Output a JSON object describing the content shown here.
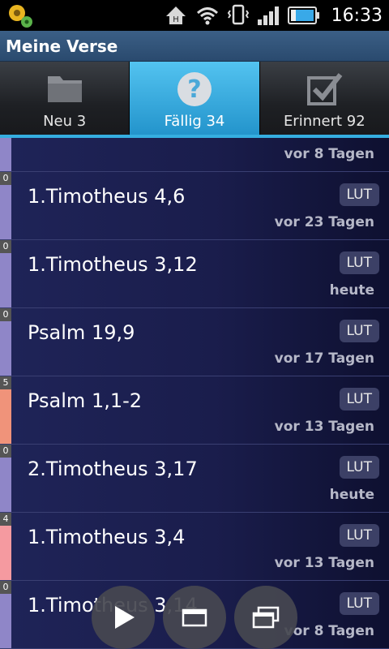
{
  "status_bar": {
    "time": "16:33",
    "icons": [
      "app-settings-icon",
      "h-network-icon",
      "wifi-icon",
      "vibrate-icon",
      "signal-icon",
      "battery-icon"
    ]
  },
  "header": {
    "title": "Meine Verse"
  },
  "tabs": [
    {
      "label": "Neu 3",
      "icon": "folder-icon",
      "active": false
    },
    {
      "label": "Fällig 34",
      "icon": "question-icon",
      "active": true
    },
    {
      "label": "Erinnert 92",
      "icon": "checkbox-icon",
      "active": false
    }
  ],
  "list": {
    "first_row": {
      "due": "vor 8 Tagen",
      "color": "#8f86c8"
    },
    "items": [
      {
        "count": "0",
        "reference": "1.Timotheus 4,6",
        "translation": "LUT",
        "due": "vor 23 Tagen",
        "color": "#8f86c8"
      },
      {
        "count": "0",
        "reference": "1.Timotheus 3,12",
        "translation": "LUT",
        "due": "heute",
        "color": "#8f86c8"
      },
      {
        "count": "0",
        "reference": "Psalm 19,9",
        "translation": "LUT",
        "due": "vor 17 Tagen",
        "color": "#8f86c8"
      },
      {
        "count": "5",
        "reference": "Psalm 1,1-2",
        "translation": "LUT",
        "due": "vor 13 Tagen",
        "color": "#f0937a"
      },
      {
        "count": "0",
        "reference": "2.Timotheus 3,17",
        "translation": "LUT",
        "due": "heute",
        "color": "#8f86c8"
      },
      {
        "count": "4",
        "reference": "1.Timotheus 3,4",
        "translation": "LUT",
        "due": "vor 13 Tagen",
        "color": "#f59aa0"
      },
      {
        "count": "0",
        "reference": "1.Timotheus 3,14",
        "translation": "LUT",
        "due": "vor 8 Tagen",
        "color": "#8f86c8"
      }
    ]
  },
  "controls": [
    "play-icon",
    "single-window-icon",
    "stacked-windows-icon"
  ]
}
